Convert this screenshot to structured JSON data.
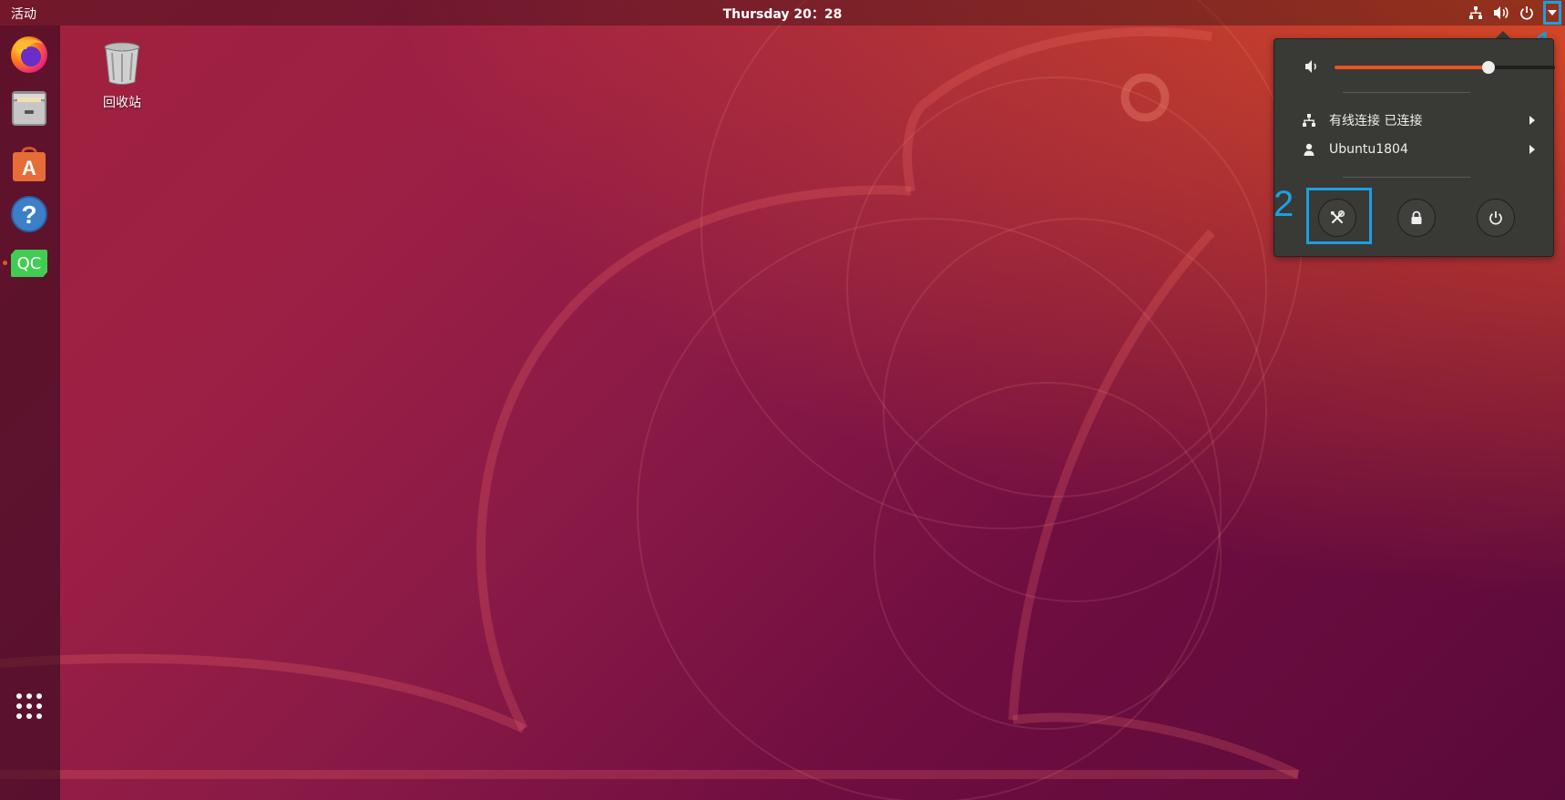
{
  "topbar": {
    "activities": "活动",
    "clock": "Thursday 20：28",
    "tray_icons": [
      "network-icon",
      "volume-icon",
      "power-icon",
      "chevron-down-icon"
    ]
  },
  "dock": {
    "items": [
      {
        "name": "firefox"
      },
      {
        "name": "files"
      },
      {
        "name": "software"
      },
      {
        "name": "help"
      },
      {
        "name": "qt-creator",
        "text": "QC",
        "running": true
      },
      {
        "name": "show-apps"
      }
    ]
  },
  "desktop": {
    "trash_label": "回收站"
  },
  "system_menu": {
    "volume_level": 0.7,
    "network_label": "有线连接 已连接",
    "user_label": "Ubuntu1804",
    "buttons": [
      "settings",
      "lock",
      "power"
    ]
  },
  "annotations": {
    "one": "1",
    "two": "2"
  },
  "colors": {
    "accent": "#e95420",
    "annotation": "#1ba0e2",
    "menu_bg": "#393936"
  }
}
